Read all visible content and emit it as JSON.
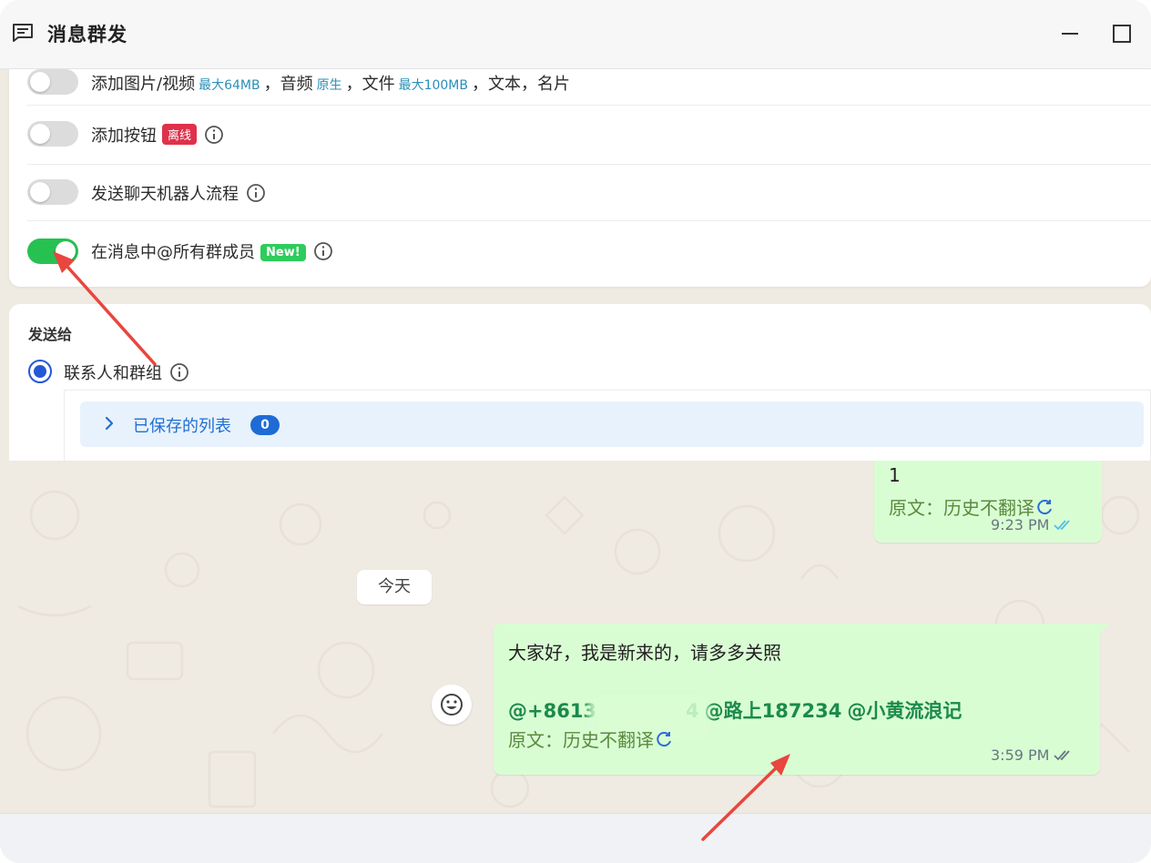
{
  "window": {
    "title": "消息群发"
  },
  "options": [
    {
      "label": "添加图片/视频",
      "hint1": "最大64MB",
      "mid1": "，音频",
      "hint2": "原生",
      "mid2": "，文件",
      "hint3": "最大100MB",
      "tail": "，文本，名片",
      "on": false
    },
    {
      "label": "添加按钮",
      "badge": "离线",
      "on": false
    },
    {
      "label": "发送聊天机器人流程",
      "on": false
    },
    {
      "label": "在消息中@所有群成员",
      "badge": "New!",
      "on": true
    }
  ],
  "send_to": {
    "title": "发送给",
    "radio_label": "联系人和群组",
    "saved_list_label": "已保存的列表",
    "saved_count": "0"
  },
  "chat": {
    "prev_message": {
      "text": "1",
      "original": "原文：历史不翻译",
      "time": "9:23 PM"
    },
    "date_chip": "今天",
    "message": {
      "line1": "大家好，我是新来的，请多多关照",
      "mentions": [
        "@+8613",
        "4",
        "@路上187234",
        "@小黄流浪记"
      ],
      "original": "原文：历史不翻译",
      "time": "3:59 PM"
    }
  },
  "colors": {
    "toggle_on": "#27c152",
    "accent_blue": "#1e6bd6",
    "bubble_green": "#d9fdd3",
    "mention_green": "#1c8a4c",
    "badge_red": "#e0314b",
    "arrow_red": "#e8463e"
  },
  "icons": {
    "title": "message-square-icon",
    "minimize": "minimize-icon",
    "maximize": "maximize-icon",
    "info": "info-icon",
    "chevron": "chevron-right-icon",
    "refresh": "refresh-icon",
    "tick": "double-check-icon",
    "emoji": "emoji-icon"
  }
}
